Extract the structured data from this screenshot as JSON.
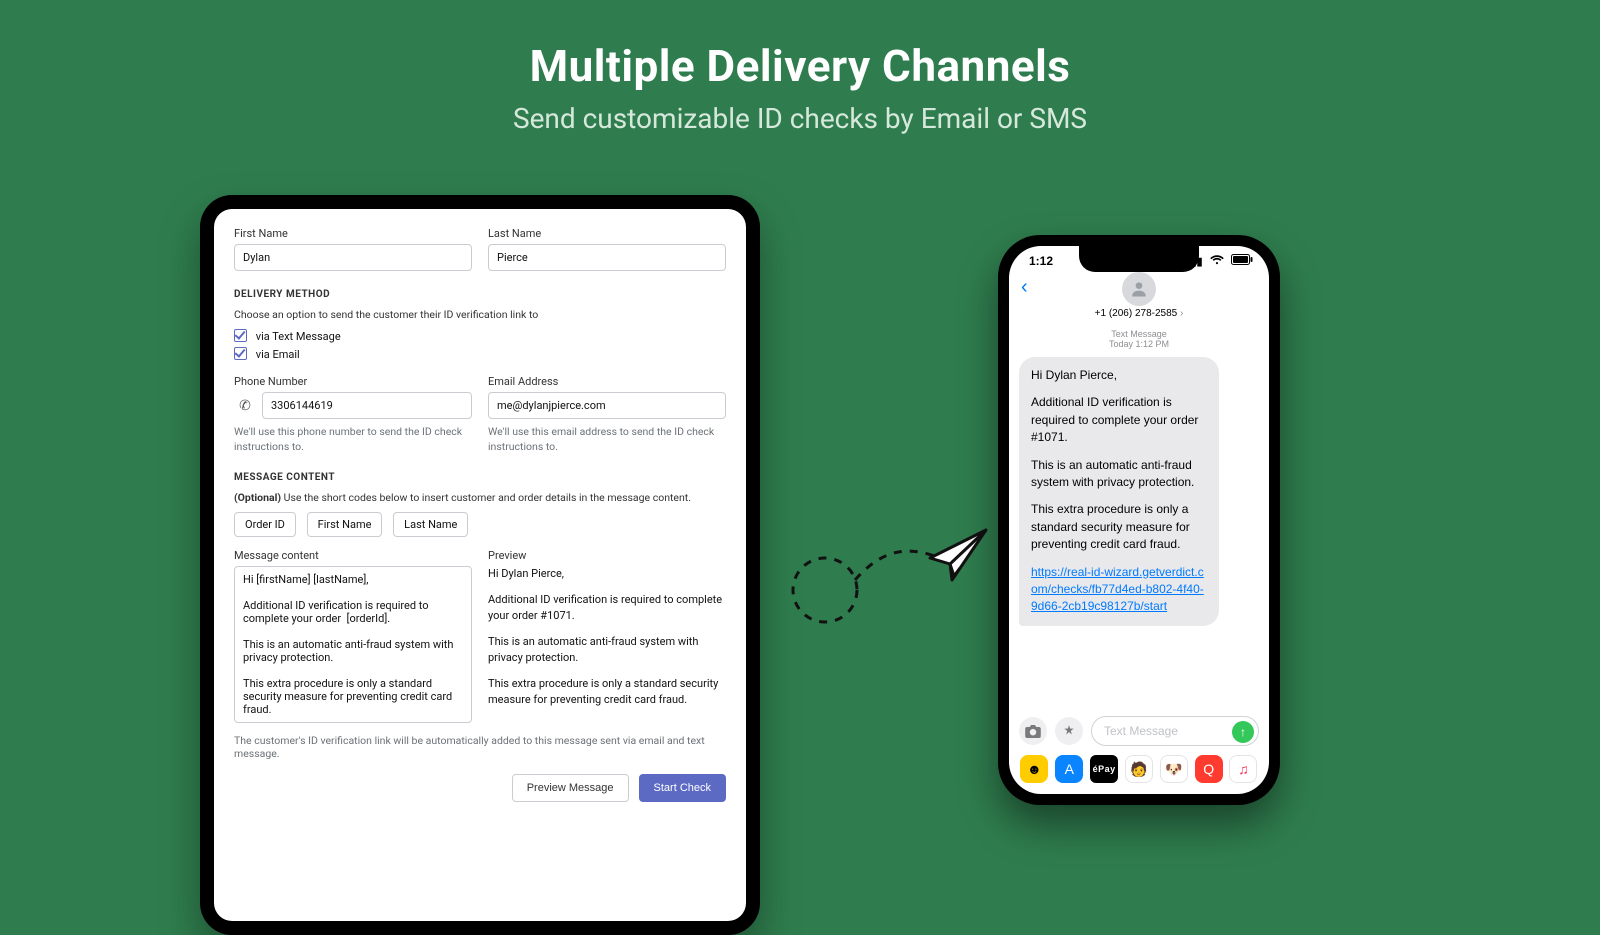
{
  "hero": {
    "title": "Multiple Delivery Channels",
    "subtitle": "Send customizable ID checks by Email or SMS"
  },
  "form": {
    "first_name_label": "First Name",
    "first_name_value": "Dylan",
    "last_name_label": "Last Name",
    "last_name_value": "Pierce",
    "delivery_section": "DELIVERY METHOD",
    "delivery_helper": "Choose an option to send the customer their ID verification link to",
    "cb_text": "via Text Message",
    "cb_email": "via Email",
    "phone_label": "Phone Number",
    "phone_value": "3306144619",
    "phone_hint": "We'll use this phone number to send the ID check instructions to.",
    "email_label": "Email Address",
    "email_value": "me@dylanjpierce.com",
    "email_hint": "We'll use this email address to send the ID check instructions to.",
    "content_section": "MESSAGE CONTENT",
    "optional_prefix": "(Optional)",
    "optional_text": " Use the short codes below to insert customer and order details in the message content.",
    "chip_order": "Order ID",
    "chip_first": "First Name",
    "chip_last": "Last Name",
    "mc_label": "Message content",
    "mc_value": "Hi [firstName] [lastName],\n\nAdditional ID verification is required to complete your order  [orderId].\n\nThis is an automatic anti-fraud system with privacy protection.\n\nThis extra procedure is only a standard security measure for preventing credit card fraud.",
    "preview_label": "Preview",
    "preview_p1": "Hi Dylan Pierce,",
    "preview_p2": "Additional ID verification is required to complete your order #1071.",
    "preview_p3": "This is an automatic anti-fraud system with privacy protection.",
    "preview_p4": "This extra procedure is only a standard security measure for preventing credit card fraud.",
    "footer_note": "The customer's ID verification link will be automatically added to this message sent via email and text message.",
    "btn_preview": "Preview Message",
    "btn_start": "Start Check"
  },
  "phone": {
    "time": "1:12",
    "sender": "+1 (206) 278-2585",
    "meta_line1": "Text Message",
    "meta_line2": "Today 1:12 PM",
    "msg_p1": "Hi Dylan Pierce,",
    "msg_p2": "Additional ID verification is required to complete your order  #1071.",
    "msg_p3": "This is an automatic anti-fraud system with privacy protection.",
    "msg_p4": "This extra procedure is only a standard security measure for preventing credit card fraud.",
    "msg_link": "https://real-id-wizard.getverdict.com/checks/fb77d4ed-b802-4f40-9d66-2cb19c98127b/start",
    "compose_placeholder": "Text Message",
    "apple_pay": "éPay"
  }
}
